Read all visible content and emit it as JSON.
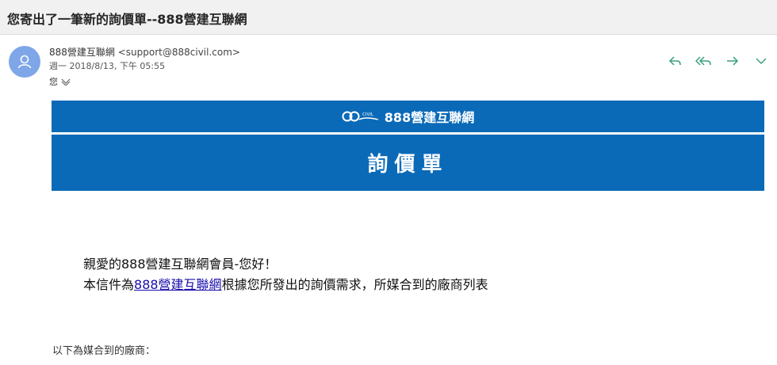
{
  "subject": "您寄出了一筆新的詢價單--888營建互聯網",
  "sender": {
    "name": "888營建互聯網",
    "email": "<support@888civil.com>",
    "date": "週一 2018/8/13, 下午 05:55",
    "recipient": "您"
  },
  "actions": {
    "icons": [
      "reply-icon",
      "reply-all-icon",
      "forward-icon",
      "more-chevron-icon"
    ]
  },
  "banner": {
    "logo_small_text": "CIVIL",
    "brand": "888營建互聯網",
    "title": "詢價單",
    "color": "#0a6ab8"
  },
  "body": {
    "greeting": "親愛的888營建互聯網會員-您好！",
    "line_prefix": "本信件為",
    "link_text": "888營建互聯網",
    "line_suffix": "根據您所發出的詢價需求，所媒合到的廠商列表",
    "footer": "以下為媒合到的廠商："
  }
}
